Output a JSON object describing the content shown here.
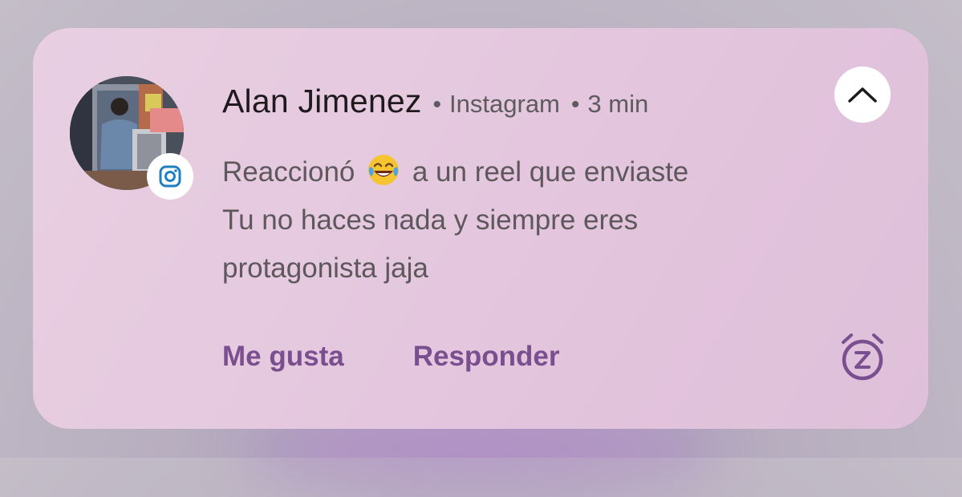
{
  "notification": {
    "sender": "Alan Jimenez",
    "separator": "•",
    "app_name": "Instagram",
    "time": "3 min",
    "message_prefix": "Reaccionó",
    "reaction_emoji": "😂",
    "message_suffix": "a un reel que enviaste",
    "message_line2": "Tu no haces nada y siempre eres",
    "message_line3": "protagonista jaja",
    "avatar_icon": "profile-photo",
    "app_icon": "instagram-icon",
    "expand_icon": "chevron-up-icon",
    "snooze_icon": "snooze-alarm-icon"
  },
  "actions": {
    "like_label": "Me gusta",
    "reply_label": "Responder"
  },
  "colors": {
    "card_background": "#e5c9df",
    "action_text": "#7a4f8f",
    "app_icon_blue": "#1f7fc1"
  }
}
